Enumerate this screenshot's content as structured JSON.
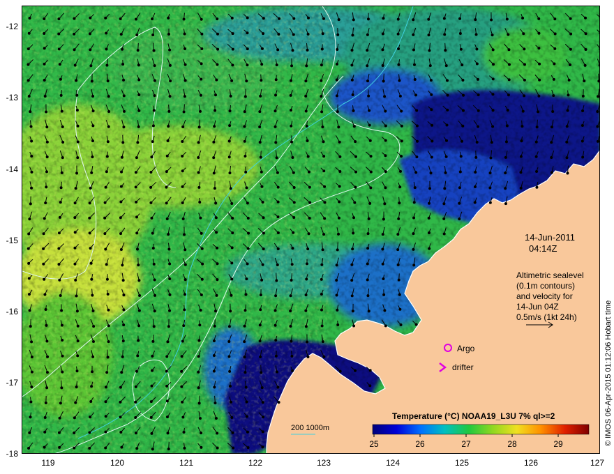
{
  "map": {
    "lon_range": [
      118.6,
      127.0
    ],
    "lat_range": [
      -18.0,
      -11.75
    ],
    "x_ticks": [
      "119",
      "120",
      "121",
      "122",
      "123",
      "124",
      "125",
      "126",
      "127"
    ],
    "y_ticks": [
      "-12",
      "-13",
      "-14",
      "-15",
      "-16",
      "-17",
      "-18"
    ],
    "land_color": "#f9c89b",
    "ocean_colors": [
      "#0a0a80",
      "#1e50d0",
      "#2ab0a0",
      "#2ec050",
      "#50c830",
      "#9ad83a",
      "#e0e83a"
    ]
  },
  "annotations": {
    "date": "14-Jun-2011",
    "time": "04:14Z",
    "description_lines": [
      "Altimetric sealevel",
      "(0.1m contours)",
      "and velocity for",
      "14-Jun 04Z",
      "0.5m/s (1kt 24h)"
    ]
  },
  "legend": {
    "argo_label": "Argo",
    "drifter_label": "drifter",
    "bathymetry_label": "200  1000m",
    "colorbar_title": "Temperature (°C) NOAA19_L3U 7% ql>=2",
    "colorbar_ticks": [
      "25",
      "26",
      "27",
      "28",
      "29"
    ],
    "colorbar_colors": [
      "#00007a",
      "#0000d8",
      "#0070ff",
      "#00c0c0",
      "#20c840",
      "#90d820",
      "#f0e020",
      "#ff9000",
      "#e02000",
      "#800000"
    ],
    "marker_color": "#e000e0"
  },
  "credit": "© IMOS 06-Apr-2015 01:12:06 Hobart time"
}
